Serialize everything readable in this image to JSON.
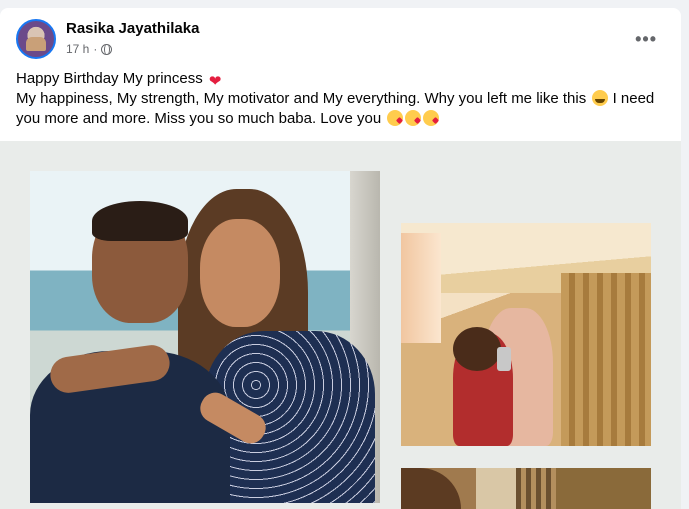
{
  "post": {
    "author": "Rasika Jayathilaka",
    "time": "17 h",
    "separator": "·",
    "menu_label": "•••",
    "line1": "Happy Birthday My princess",
    "line2": "My happiness, My strength, My motivator and My everything. Why you left me like this",
    "line3": "I need you more and more. Miss you so much baba. Love you",
    "icons": {
      "audience": "globe-icon",
      "heart": "red-heart-emoji",
      "crying": "crying-face-emoji",
      "kiss": "face-blowing-kiss-emoji"
    },
    "colors": {
      "avatar_ring": "#1877f2",
      "heart": "#e41e3f",
      "name": "#050505",
      "meta": "#65676b"
    }
  }
}
